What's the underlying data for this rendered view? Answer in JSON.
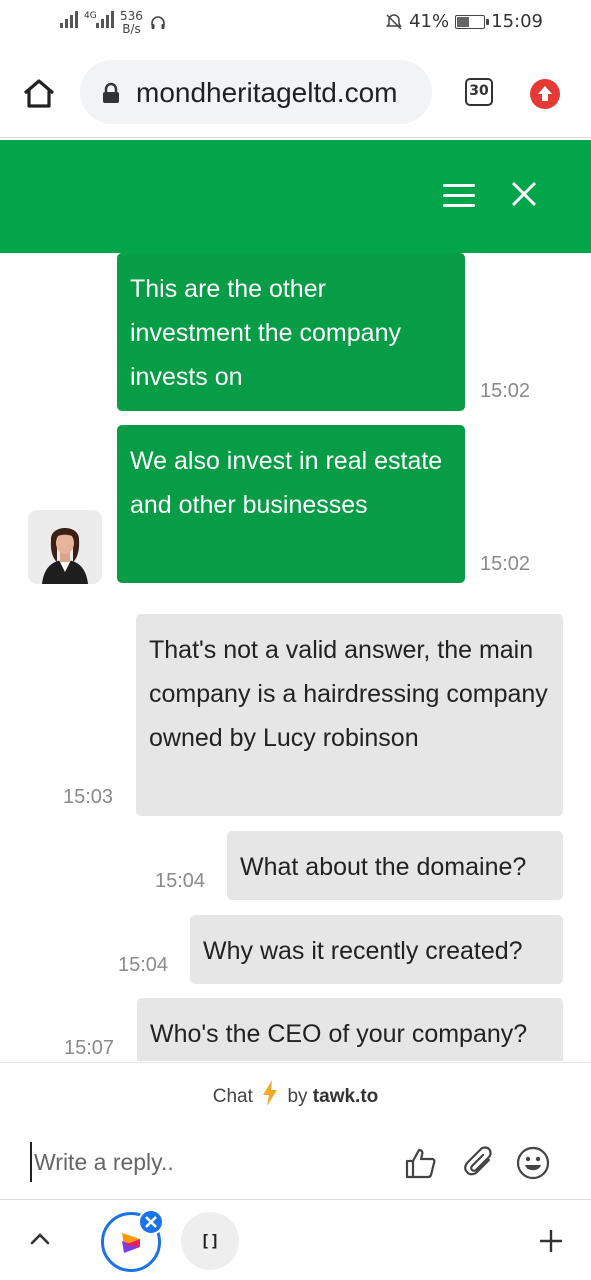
{
  "status_bar": {
    "network": "4G",
    "speed_value": "536",
    "speed_unit": "B/s",
    "battery": "41%",
    "battery_level": 0.41,
    "time": "15:09"
  },
  "browser": {
    "url": "mondheritageltd.com",
    "tab_count": "30"
  },
  "chat": {
    "messages": [
      {
        "from": "agent",
        "text": "This are the other investment the company invests on",
        "time": "15:02"
      },
      {
        "from": "agent",
        "text": "We also invest in real estate and other businesses",
        "time": "15:02"
      },
      {
        "from": "visitor",
        "text": "That's not a valid answer, the main company is a hairdressing company owned by Lucy robinson",
        "time": "15:03"
      },
      {
        "from": "visitor",
        "text": "What about the domaine?",
        "time": "15:04"
      },
      {
        "from": "visitor",
        "text": "Why was it recently created?",
        "time": "15:04"
      },
      {
        "from": "visitor",
        "text": "Who's the CEO of your company?",
        "time": "15:07"
      }
    ],
    "branding": {
      "chat_label": "Chat",
      "by_label": "by",
      "brand": "tawk.to"
    },
    "reply_placeholder": "Write a reply..",
    "colors": {
      "header": "#02a54a",
      "agent_bubble": "#079c46",
      "visitor_bubble": "#e6e6e6"
    }
  },
  "bottom_nav": {
    "bracket_label": "[]"
  },
  "icons": [
    "home-icon",
    "lock-icon",
    "tabs-icon",
    "update-icon",
    "menu-icon",
    "close-icon",
    "thumbs-up-icon",
    "paperclip-icon",
    "emoji-icon",
    "chevron-up-icon",
    "plus-icon"
  ]
}
